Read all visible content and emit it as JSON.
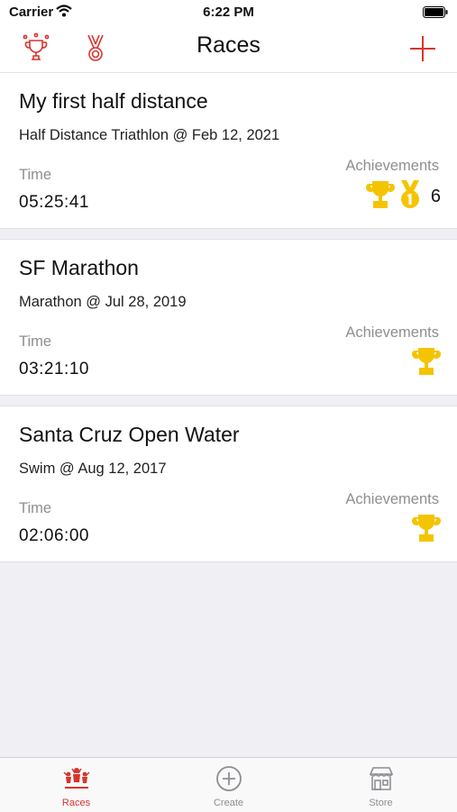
{
  "status_bar": {
    "carrier": "Carrier",
    "time": "6:22 PM"
  },
  "nav": {
    "title": "Races"
  },
  "races": [
    {
      "title": "My first half distance",
      "subtitle": "Half Distance Triathlon @ Feb 12, 2021",
      "time_label": "Time",
      "time": "05:25:41",
      "achievements_label": "Achievements",
      "achievement_count": "6"
    },
    {
      "title": "SF Marathon",
      "subtitle": "Marathon @ Jul 28, 2019",
      "time_label": "Time",
      "time": "03:21:10",
      "achievements_label": "Achievements"
    },
    {
      "title": "Santa Cruz Open Water",
      "subtitle": "Swim @ Aug 12, 2017",
      "time_label": "Time",
      "time": "02:06:00",
      "achievements_label": "Achievements"
    }
  ],
  "tabs": [
    {
      "label": "Races",
      "icon": "races-icon"
    },
    {
      "label": "Create",
      "icon": "plus-circle-icon"
    },
    {
      "label": "Store",
      "icon": "store-icon"
    }
  ],
  "colors": {
    "accent": "#d9342b",
    "trophy": "#f5c400",
    "background": "#efeff4"
  }
}
